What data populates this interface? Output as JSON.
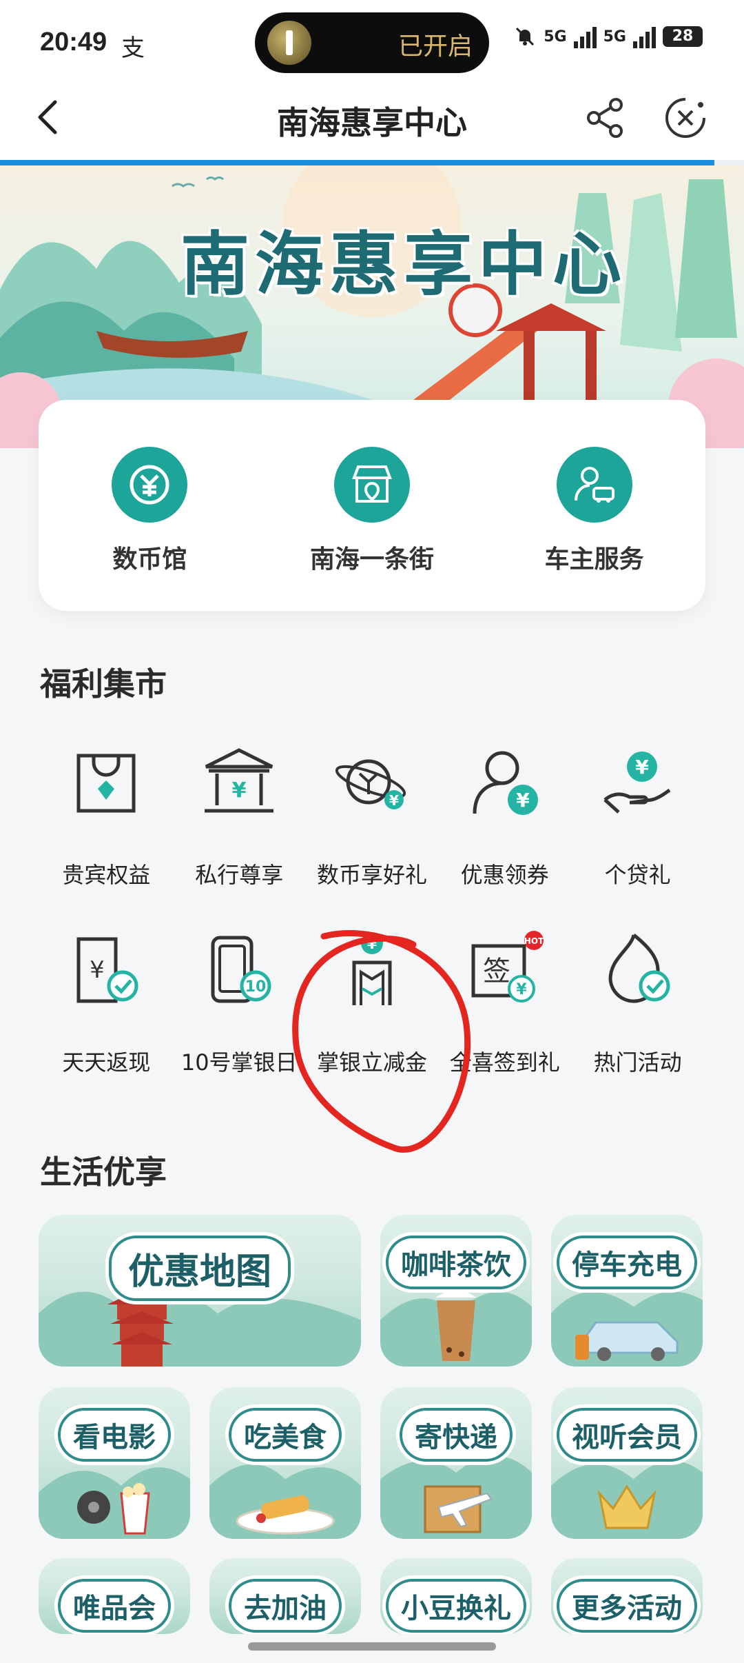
{
  "status": {
    "time": "20:49",
    "extra_glyph": "支",
    "pill_text": "已开启",
    "net1": "5G",
    "net2": "5G",
    "battery": "28"
  },
  "nav": {
    "title": "南海惠享中心",
    "progress_percent": 96
  },
  "banner": {
    "title": "南海惠享中心"
  },
  "quick": [
    {
      "label": "数币馆",
      "icon": "digital-currency-icon"
    },
    {
      "label": "南海一条街",
      "icon": "store-icon"
    },
    {
      "label": "车主服务",
      "icon": "car-owner-icon"
    }
  ],
  "welfare": {
    "title": "福利集市",
    "items": [
      {
        "label": "贵宾权益",
        "icon": "vip-bag-icon"
      },
      {
        "label": "私行尊享",
        "icon": "bank-building-icon"
      },
      {
        "label": "数币享好礼",
        "icon": "digital-coin-gift-icon"
      },
      {
        "label": "优惠领券",
        "icon": "coupon-user-icon"
      },
      {
        "label": "个贷礼",
        "icon": "loan-hand-icon"
      },
      {
        "label": "天天返现",
        "icon": "cashback-icon"
      },
      {
        "label": "10号掌银日",
        "icon": "phone-10-icon"
      },
      {
        "label": "掌银立减金",
        "icon": "discount-gate-icon"
      },
      {
        "label": "全喜签到礼",
        "icon": "checkin-icon",
        "badge": "HOT"
      },
      {
        "label": "热门活动",
        "icon": "flame-icon"
      }
    ]
  },
  "life": {
    "title": "生活优享",
    "cards": [
      {
        "label": "优惠地图"
      },
      {
        "label": "咖啡茶饮"
      },
      {
        "label": "停车充电"
      },
      {
        "label": "看电影"
      },
      {
        "label": "吃美食"
      },
      {
        "label": "寄快递"
      },
      {
        "label": "视听会员"
      },
      {
        "label": "唯品会"
      },
      {
        "label": "去加油"
      },
      {
        "label": "小豆换礼"
      },
      {
        "label": "更多活动"
      }
    ]
  },
  "colors": {
    "teal": "#1ea59a",
    "accent_blue": "#1a8fe0",
    "annotation_red": "#e3261f"
  }
}
